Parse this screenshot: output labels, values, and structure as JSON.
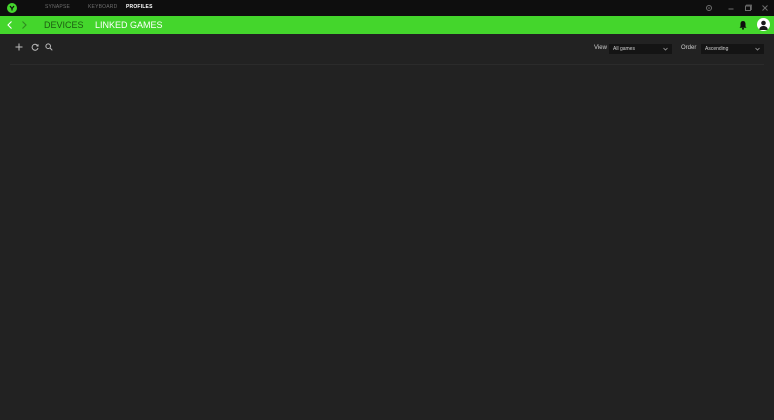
{
  "titlebar": {
    "tabs": [
      {
        "label": "SYNAPSE",
        "active": false
      },
      {
        "label": "KEYBOARD",
        "active": false
      },
      {
        "label": "PROFILES",
        "active": true
      }
    ],
    "controls": [
      "gear-icon",
      "minimize-icon",
      "restore-icon",
      "close-icon"
    ]
  },
  "navbar": {
    "tabs": [
      {
        "label": "DEVICES",
        "active": false
      },
      {
        "label": "LINKED GAMES",
        "active": true
      }
    ]
  },
  "toolbar": {
    "view_label": "View",
    "view_value": "All games",
    "order_label": "Order",
    "order_value": "Ascending"
  },
  "colors": {
    "accent": "#44d62c",
    "titlebar": "#0e0e0e",
    "background": "#222222"
  }
}
